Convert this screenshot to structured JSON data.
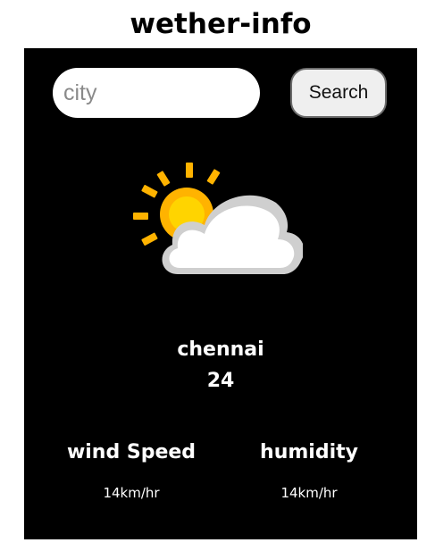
{
  "app": {
    "title": "wether-info"
  },
  "search": {
    "placeholder": "city",
    "value": "",
    "button_label": "Search"
  },
  "weather": {
    "icon": "partly-cloudy-icon",
    "city": "chennai",
    "temperature": "24"
  },
  "stats": {
    "wind": {
      "label": "wind Speed",
      "value": "14km/hr"
    },
    "humidity": {
      "label": "humidity",
      "value": "14km/hr"
    }
  },
  "colors": {
    "card_background": "#000000",
    "sun": "#ffb300",
    "cloud": "#ffffff"
  }
}
